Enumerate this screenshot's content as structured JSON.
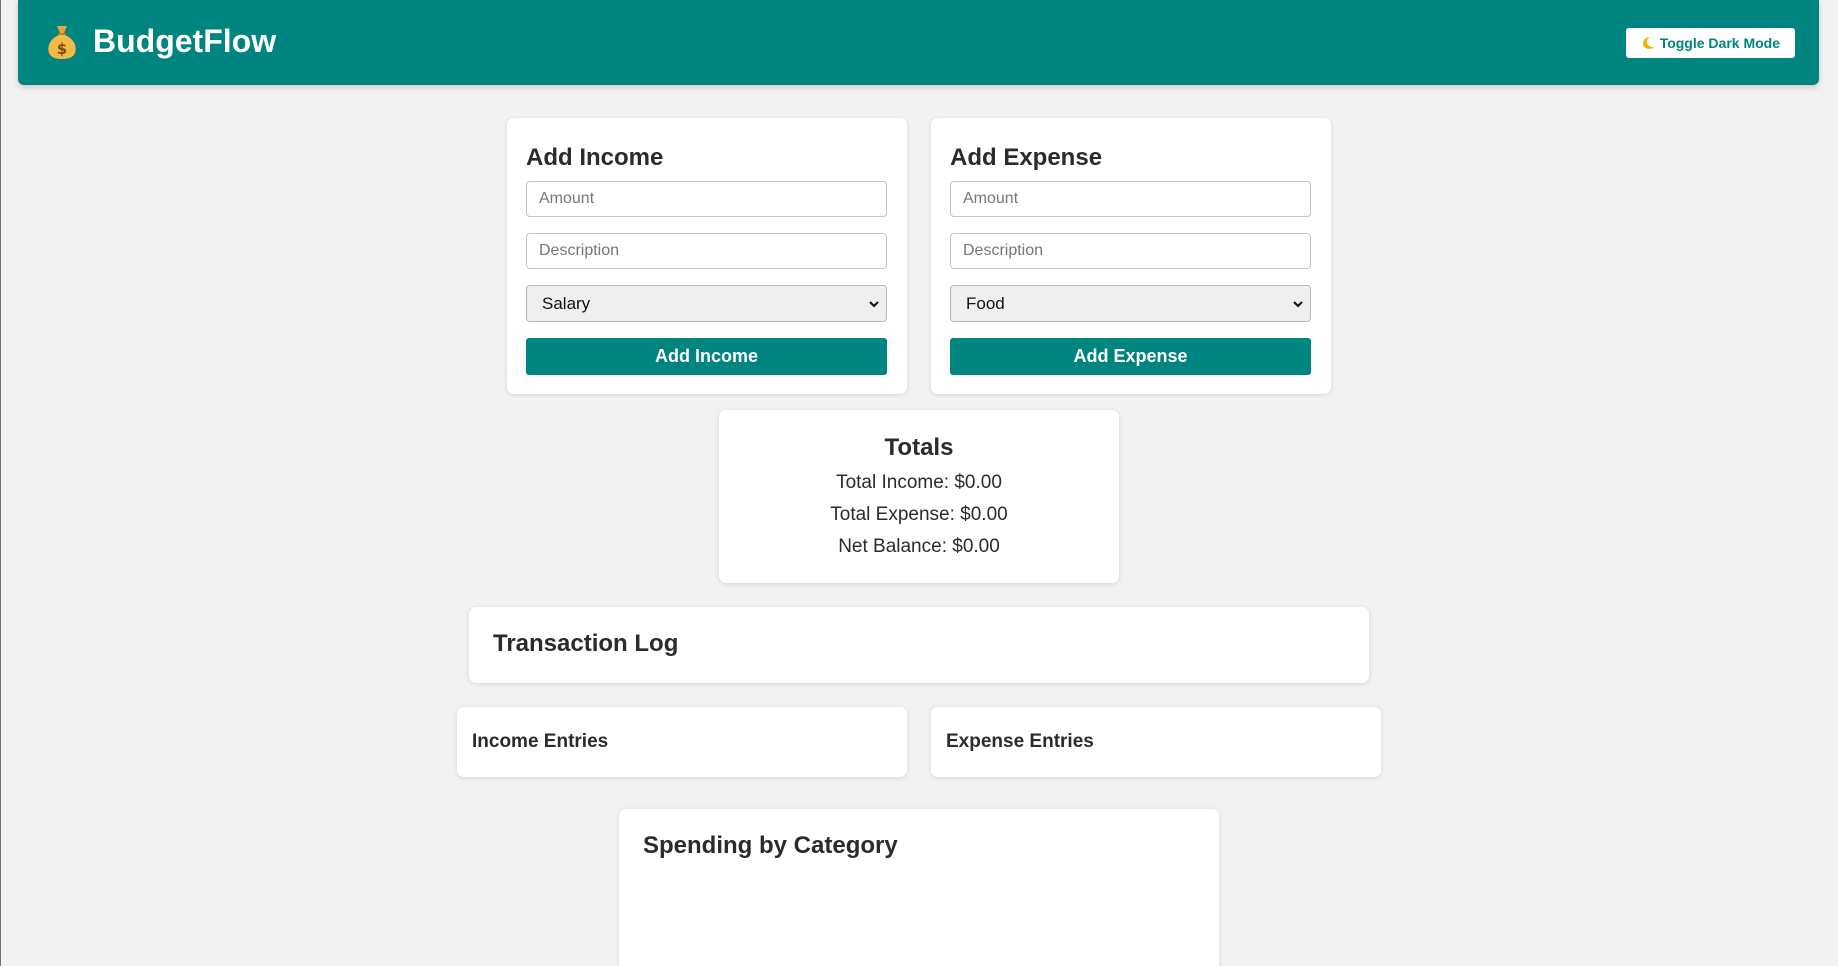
{
  "app": {
    "title": "BudgetFlow",
    "brand_color": "#008480",
    "logo_icon": "money-bag-icon"
  },
  "header": {
    "dark_mode_label": "Toggle Dark Mode",
    "dark_mode_icon": "moon-icon"
  },
  "income_form": {
    "title": "Add Income",
    "amount_placeholder": "Amount",
    "description_placeholder": "Description",
    "category_selected": "Salary",
    "submit_label": "Add Income"
  },
  "expense_form": {
    "title": "Add Expense",
    "amount_placeholder": "Amount",
    "description_placeholder": "Description",
    "category_selected": "Food",
    "submit_label": "Add Expense"
  },
  "totals": {
    "title": "Totals",
    "income": "Total Income: $0.00",
    "expense": "Total Expense: $0.00",
    "net": "Net Balance: $0.00"
  },
  "transaction_log": {
    "title": "Transaction Log",
    "income_title": "Income Entries",
    "expense_title": "Expense Entries"
  },
  "spending": {
    "title": "Spending by Category"
  }
}
